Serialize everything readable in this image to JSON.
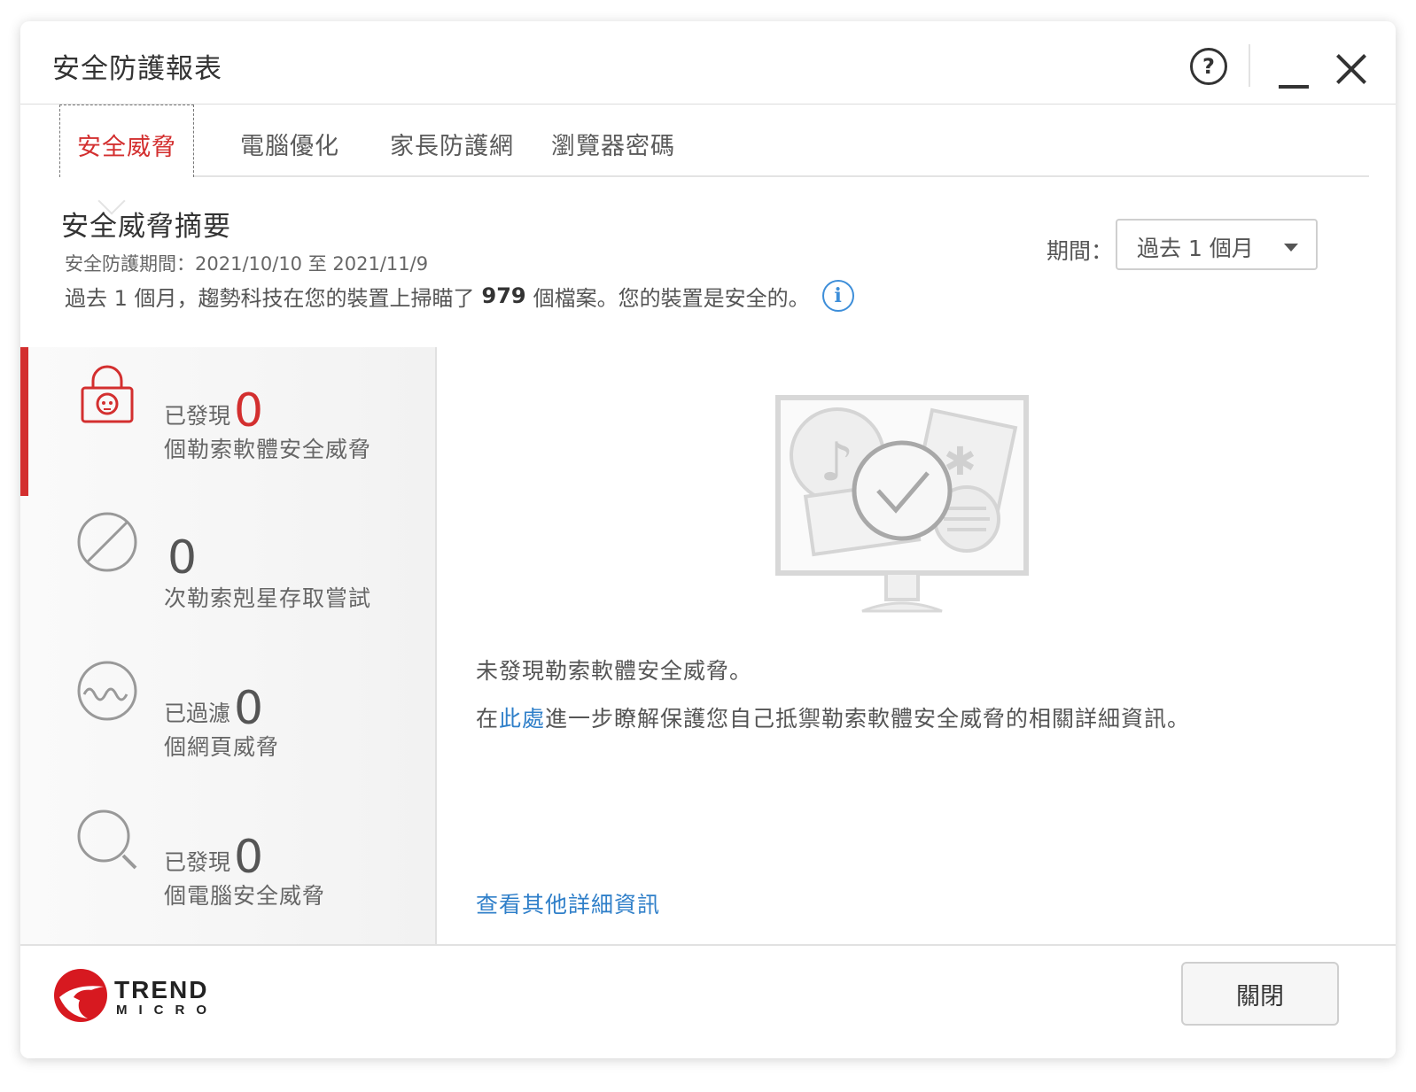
{
  "window": {
    "title": "安全防護報表"
  },
  "tabs": [
    {
      "label": "安全威脅",
      "active": true
    },
    {
      "label": "電腦優化",
      "active": false
    },
    {
      "label": "家長防護網",
      "active": false
    },
    {
      "label": "瀏覽器密碼",
      "active": false
    }
  ],
  "summary": {
    "heading": "安全威脅摘要",
    "period_text": "安全防護期間：2021/10/10 至 2021/11/9",
    "scan_prefix": "過去 1 個月，趨勢科技在您的裝置上掃瞄了",
    "scan_count": "979",
    "scan_suffix": "個檔案。您的裝置是安全的。"
  },
  "period": {
    "label": "期間：",
    "selected": "過去 1 個月"
  },
  "stats": [
    {
      "prefix": "已發現",
      "count": "0",
      "description": "個勒索軟體安全威脅",
      "icon": "lock-skull-icon",
      "selected": true
    },
    {
      "prefix": "",
      "count": "0",
      "description": "次勒索剋星存取嘗試",
      "icon": "no-entry-icon",
      "selected": false
    },
    {
      "prefix": "已過濾",
      "count": "0",
      "description": "個網頁威脅",
      "icon": "web-wave-icon",
      "selected": false
    },
    {
      "prefix": "已發現",
      "count": "0",
      "description": "個電腦安全威脅",
      "icon": "magnifier-icon",
      "selected": false
    }
  ],
  "detail": {
    "message": "未發現勒索軟體安全威脅。",
    "learn_prefix": "在",
    "learn_link": "此處",
    "learn_suffix": "進一步瞭解保護您自己抵禦勒索軟體安全威脅的相關詳細資訊。",
    "more_link": "查看其他詳細資訊"
  },
  "footer": {
    "logo_word": "TREND",
    "logo_sub": "MICRO",
    "close_label": "關閉"
  },
  "colors": {
    "accent": "#d32f2f",
    "link": "#2f7fc9"
  }
}
